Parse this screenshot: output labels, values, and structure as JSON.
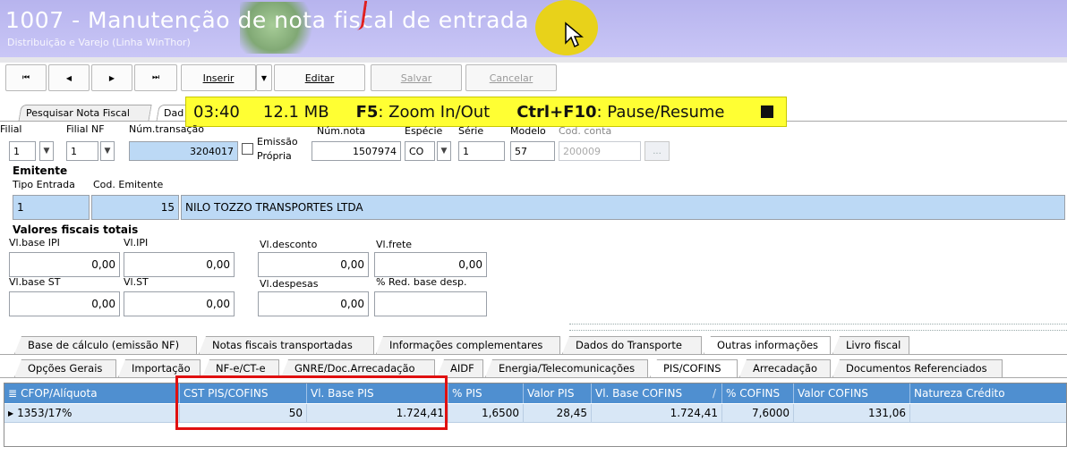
{
  "window": {
    "title": "1007 - Manutenção de nota fiscal de entrada",
    "subtitle": "Distribuição e Varejo (Linha WinThor)"
  },
  "toolbar": {
    "first_glyph": "⏮",
    "prev_glyph": "◀",
    "next_glyph": "▶",
    "last_glyph": "⏭",
    "insert_label": "Inserir",
    "dropdown_glyph": "▼",
    "edit_label": "Editar",
    "save_label": "Salvar",
    "cancel_label": "Cancelar"
  },
  "recording": {
    "time": "03:40",
    "size": "12.1 MB",
    "key1": "F5",
    "action1": ": Zoom In/Out",
    "key2": "Ctrl+F10",
    "action2": ": Pause/Resume"
  },
  "top_tabs": {
    "search": "Pesquisar Nota Fiscal",
    "data": "Dad"
  },
  "header": {
    "filial_label": "Filial",
    "filial_value": "1",
    "filial_nf_label": "Filial NF",
    "filial_nf_value": "1",
    "num_transacao_label": "Núm.transação",
    "num_transacao_value": "3204017",
    "emissao_propria_label1": "Emissão",
    "emissao_propria_label2": "Própria",
    "num_nota_label": "Núm.nota",
    "num_nota_value": "1507974",
    "especie_label": "Espécie",
    "especie_value": "CO",
    "serie_label": "Série",
    "serie_value": "1",
    "modelo_label": "Modelo",
    "modelo_value": "57",
    "cod_conta_label": "Cod. conta",
    "cod_conta_value": "200009",
    "dots": "..."
  },
  "emitente": {
    "section_title": "Emitente",
    "tipo_entrada_label": "Tipo Entrada",
    "tipo_entrada_value": "1",
    "cod_emitente_label": "Cod. Emitente",
    "cod_emitente_value": "15",
    "nome_value": "NILO TOZZO TRANSPORTES LTDA"
  },
  "valores": {
    "section_title": "Valores fiscais totais",
    "base_ipi_label": "Vl.base IPI",
    "base_ipi_value": "0,00",
    "ipi_label": "Vl.IPI",
    "ipi_value": "0,00",
    "desconto_label": "Vl.desconto",
    "desconto_value": "0,00",
    "frete_label": "Vl.frete",
    "frete_value": "0,00",
    "base_st_label": "Vl.base ST",
    "base_st_value": "0,00",
    "st_label": "Vl.ST",
    "st_value": "0,00",
    "despesas_label": "Vl.despesas",
    "despesas_value": "0,00",
    "red_base_label": "% Red. base desp.",
    "red_base_value": ""
  },
  "tabs_row1": [
    {
      "label": "Base de cálculo (emissão NF)"
    },
    {
      "label": "Notas fiscais transportadas"
    },
    {
      "label": "Informações complementares"
    },
    {
      "label": "Dados do Transporte"
    },
    {
      "label": "Outras informações"
    },
    {
      "label": "Livro fiscal"
    }
  ],
  "tabs_row2": [
    {
      "label": "Opções Gerais"
    },
    {
      "label": "Importação"
    },
    {
      "label": "NF-e/CT-e"
    },
    {
      "label": "GNRE/Doc.Arrecadação"
    },
    {
      "label": "AIDF"
    },
    {
      "label": "Energia/Telecomunicações"
    },
    {
      "label": "PIS/COFINS"
    },
    {
      "label": "Arrecadação"
    },
    {
      "label": "Documentos Referenciados"
    }
  ],
  "grid": {
    "columns": [
      "CFOP/Alíquota",
      "CST PIS/COFINS",
      "Vl. Base PIS",
      "% PIS",
      "Valor PIS",
      "Vl. Base COFINS",
      "% COFINS",
      "Valor COFINS",
      "Natureza Crédito"
    ],
    "row": [
      "1353/17%",
      "50",
      "1.724,41",
      "1,6500",
      "28,45",
      "1.724,41",
      "7,6000",
      "131,06",
      ""
    ],
    "row_indicator": "▶",
    "menu_glyph": "≣",
    "sort_glyph": "/"
  },
  "colors": {
    "title_bar": "#b7b4ee",
    "grid_header": "#4f8fd0",
    "grid_row": "#d8e7f6",
    "field_blue": "#bcd9f5",
    "highlight": "#e01010",
    "recording_bar": "#ffff33"
  }
}
